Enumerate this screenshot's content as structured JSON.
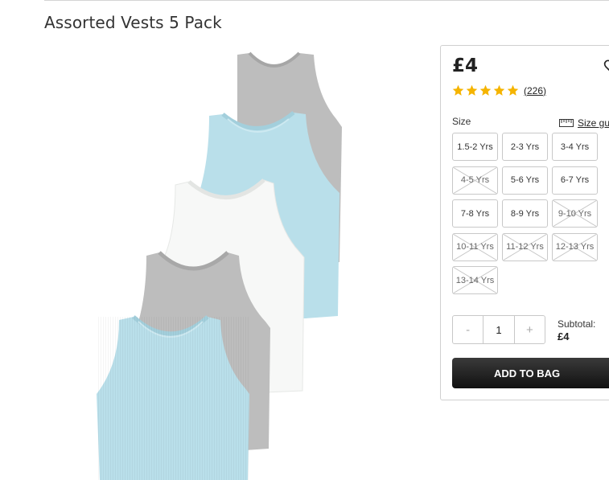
{
  "product": {
    "title": "Assorted Vests 5 Pack",
    "price": "£4",
    "rating": {
      "stars": 5,
      "count": "(226)"
    },
    "size_label": "Size",
    "size_guide_label": "Size gu",
    "sizes": [
      {
        "label": "1.5-2 Yrs",
        "available": true
      },
      {
        "label": "2-3 Yrs",
        "available": true
      },
      {
        "label": "3-4 Yrs",
        "available": true
      },
      {
        "label": "4-5 Yrs",
        "available": false
      },
      {
        "label": "5-6 Yrs",
        "available": true
      },
      {
        "label": "6-7 Yrs",
        "available": true
      },
      {
        "label": "7-8 Yrs",
        "available": true
      },
      {
        "label": "8-9 Yrs",
        "available": true
      },
      {
        "label": "9-10 Yrs",
        "available": false
      },
      {
        "label": "10-11 Yrs",
        "available": false
      },
      {
        "label": "11-12 Yrs",
        "available": false
      },
      {
        "label": "12-13 Yrs",
        "available": false
      },
      {
        "label": "13-14 Yrs",
        "available": false
      }
    ],
    "quantity": {
      "minus": "-",
      "value": "1",
      "plus": "+"
    },
    "subtotal_label": "Subtotal:",
    "subtotal_value": "£4",
    "add_to_bag": "ADD TO BAG"
  },
  "colors": {
    "star": "#f5b400",
    "button": "#1a1a1a",
    "vest_grey": "#bdbdbd",
    "vest_blue": "#b9dfea",
    "vest_white": "#f7f8f7"
  }
}
